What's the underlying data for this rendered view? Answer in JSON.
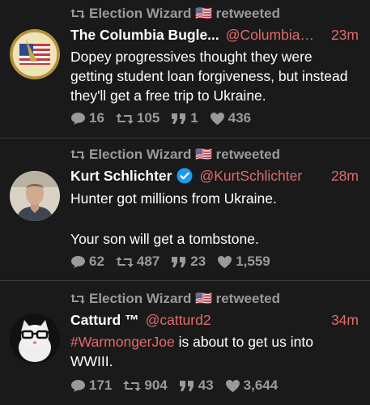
{
  "tweets": [
    {
      "retweeter": "Election Wizard",
      "flag": "🇺🇸",
      "retweet_label": "retweeted",
      "name": "The Columbia Bugle...",
      "handle": "@ColumbiaBu...",
      "time": "23m",
      "verified": false,
      "avatar_icon": "columbia-bugle-avatar",
      "body_lines": [
        "Dopey progressives thought they were",
        "getting student loan forgiveness, but instead",
        "they'll get a free trip to Ukraine."
      ],
      "replies": "16",
      "retweets": "105",
      "quotes": "1",
      "likes": "436"
    },
    {
      "retweeter": "Election Wizard",
      "flag": "🇺🇸",
      "retweet_label": "retweeted",
      "name": "Kurt Schlichter",
      "handle": "@KurtSchlichter",
      "time": "28m",
      "verified": true,
      "avatar_icon": "kurt-schlichter-avatar",
      "body_lines": [
        "Hunter got millions from Ukraine.",
        "",
        "Your son will get a tombstone."
      ],
      "replies": "62",
      "retweets": "487",
      "quotes": "23",
      "likes": "1,559"
    },
    {
      "retweeter": "Election Wizard",
      "flag": "🇺🇸",
      "retweet_label": "retweeted",
      "name": "Catturd ™",
      "handle": "@catturd2",
      "time": "34m",
      "verified": false,
      "avatar_icon": "catturd-avatar",
      "hashtag": "#WarmongerJoe",
      "body_rest": " is about to get us into",
      "body_line2": "WWIII.",
      "replies": "171",
      "retweets": "904",
      "quotes": "43",
      "likes": "3,644"
    }
  ],
  "colors": {
    "background": "#1a1a1a",
    "accent": "#e46a6a",
    "muted": "#9a9a9a",
    "verified": "#1d9bf0"
  }
}
